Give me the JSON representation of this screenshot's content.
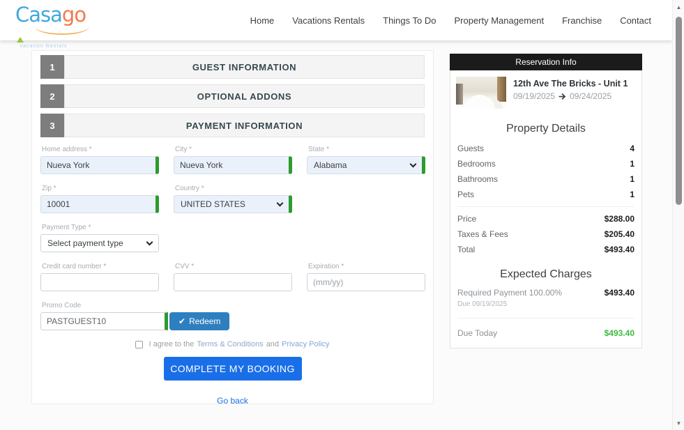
{
  "header": {
    "logo": {
      "text_blue": "Casa",
      "text_orange": "go",
      "tagline": "Vacation Rentals"
    },
    "nav": [
      {
        "label": "Home"
      },
      {
        "label": "Vacations Rentals"
      },
      {
        "label": "Things To Do"
      },
      {
        "label": "Property Management"
      },
      {
        "label": "Franchise"
      },
      {
        "label": "Contact"
      }
    ]
  },
  "steps": [
    {
      "number": "1",
      "title": "GUEST INFORMATION"
    },
    {
      "number": "2",
      "title": "OPTIONAL ADDONS"
    },
    {
      "number": "3",
      "title": "PAYMENT INFORMATION"
    }
  ],
  "form": {
    "home_address": {
      "label": "Home address *",
      "value": "Nueva York"
    },
    "city": {
      "label": "City *",
      "value": "Nueva York"
    },
    "state": {
      "label": "State *",
      "value": "Alabama"
    },
    "zip": {
      "label": "Zip *",
      "value": "10001"
    },
    "country": {
      "label": "Country *",
      "value": "UNITED STATES"
    },
    "payment_type": {
      "label": "Payment Type *",
      "value": "Select payment type"
    },
    "credit_card": {
      "label": "Credit card number *",
      "value": ""
    },
    "cvv": {
      "label": "CVV *",
      "value": ""
    },
    "expiration": {
      "label": "Expiration *",
      "placeholder": "(mm/yy)"
    },
    "promo": {
      "label": "Promo Code",
      "value": "PASTGUEST10",
      "redeem_label": "Redeem",
      "redeem_icon": "✔"
    },
    "agree": {
      "prefix": "I agree to the",
      "terms_link": "Terms & Conditions",
      "conjunction": "and",
      "privacy_link": "Privacy Policy"
    },
    "submit_label": "COMPLETE MY BOOKING",
    "back_label": "Go back"
  },
  "sidebar": {
    "header": "Reservation Info",
    "property_name": "12th Ave The Bricks - Unit 1",
    "date_from": "09/19/2025",
    "date_to": "09/24/2025",
    "details_title": "Property Details",
    "details": [
      {
        "label": "Guests",
        "value": "4"
      },
      {
        "label": "Bedrooms",
        "value": "1"
      },
      {
        "label": "Bathrooms",
        "value": "1"
      },
      {
        "label": "Pets",
        "value": "1"
      }
    ],
    "pricing": [
      {
        "label": "Price",
        "value": "$288.00"
      },
      {
        "label": "Taxes & Fees",
        "value": "$205.40"
      },
      {
        "label": "Total",
        "value": "$493.40"
      }
    ],
    "charges_title": "Expected Charges",
    "required_payment": {
      "label": "Required Payment 100.00%",
      "value": "$493.40",
      "due_note": "Due 09/19/2025"
    },
    "due_today": {
      "label": "Due Today",
      "value": "$493.40"
    }
  },
  "scrollbar": {
    "up_icon": "▲",
    "down_icon": "▼"
  },
  "colors": {
    "accent_blue": "#1a6fe8",
    "valid_green": "#2d9b2d",
    "redeem_blue": "#2e7fbf",
    "due_today_green": "#3dbb3d",
    "sidebar_header_bg": "#1b1b1b",
    "logo_blue": "#41a8dc",
    "logo_orange": "#f4794b"
  }
}
